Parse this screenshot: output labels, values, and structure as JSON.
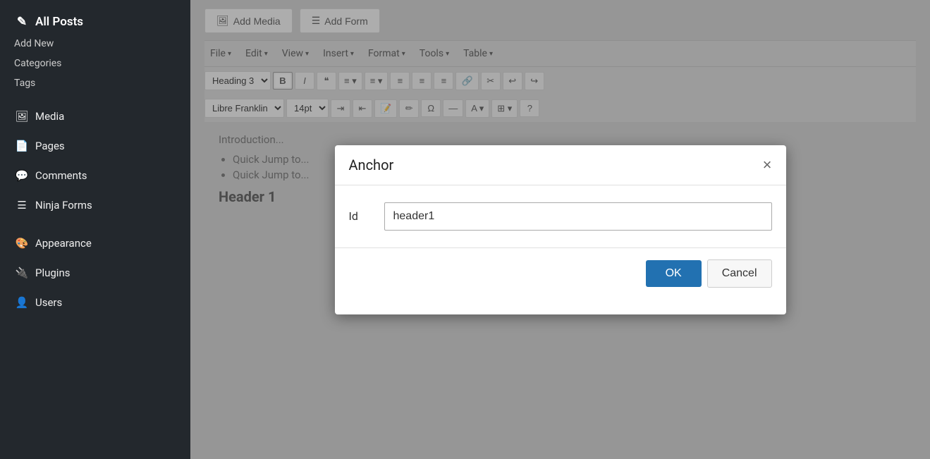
{
  "sidebar": {
    "items": [
      {
        "label": "All Posts",
        "type": "top",
        "icon": "posts-icon"
      },
      {
        "label": "Add New",
        "type": "sub",
        "icon": ""
      },
      {
        "label": "Categories",
        "type": "sub",
        "icon": ""
      },
      {
        "label": "Tags",
        "type": "sub",
        "icon": ""
      },
      {
        "label": "Media",
        "type": "main",
        "icon": "media-icon"
      },
      {
        "label": "Pages",
        "type": "main",
        "icon": "pages-icon"
      },
      {
        "label": "Comments",
        "type": "main",
        "icon": "comments-icon"
      },
      {
        "label": "Ninja Forms",
        "type": "main",
        "icon": "forms-icon"
      },
      {
        "label": "Appearance",
        "type": "main",
        "icon": "appearance-icon"
      },
      {
        "label": "Plugins",
        "type": "main",
        "icon": "plugins-icon"
      },
      {
        "label": "Users",
        "type": "main",
        "icon": "users-icon"
      }
    ]
  },
  "toolbar": {
    "add_media_label": "Add Media",
    "add_form_label": "Add Form"
  },
  "menu_bar": {
    "items": [
      {
        "label": "File"
      },
      {
        "label": "Edit"
      },
      {
        "label": "View"
      },
      {
        "label": "Insert"
      },
      {
        "label": "Format"
      },
      {
        "label": "Tools"
      },
      {
        "label": "Table"
      }
    ]
  },
  "format_bar": {
    "heading_select": "Heading 3",
    "font_select": "Libre Franklin",
    "size_select": "14pt",
    "buttons": [
      "B",
      "I",
      "❝",
      "≡",
      "≡",
      "≡",
      "≡",
      "≡",
      "🔗",
      "✂",
      "↩",
      "↪"
    ]
  },
  "content": {
    "intro_text": "Introduction...",
    "list_items": [
      "Quick Jump to...",
      "Quick Jump to..."
    ],
    "header1_text": "Header 1"
  },
  "modal": {
    "title": "Anchor",
    "close_label": "×",
    "id_label": "Id",
    "id_value": "header1",
    "ok_label": "OK",
    "cancel_label": "Cancel"
  }
}
